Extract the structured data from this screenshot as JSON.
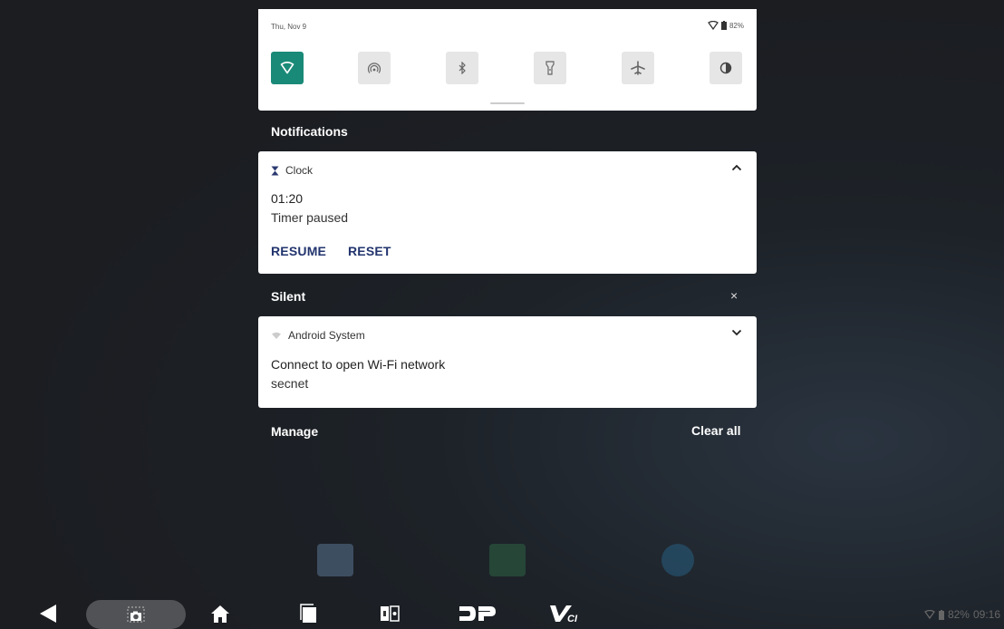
{
  "quick_settings": {
    "date": "Thu, Nov 9",
    "battery": "82%",
    "tiles": [
      {
        "name": "wifi",
        "icon": "wifi-icon",
        "active": true
      },
      {
        "name": "hotspot",
        "icon": "hotspot-icon",
        "active": false
      },
      {
        "name": "bluetooth",
        "icon": "bluetooth-icon",
        "active": false
      },
      {
        "name": "flashlight",
        "icon": "flashlight-icon",
        "active": false
      },
      {
        "name": "airplane",
        "icon": "airplane-icon",
        "active": false
      },
      {
        "name": "dark-theme",
        "icon": "contrast-icon",
        "active": false
      }
    ]
  },
  "notifications": {
    "heading": "Notifications",
    "clock": {
      "app": "Clock",
      "time": "01:20",
      "status": "Timer paused",
      "resume": "RESUME",
      "reset": "RESET"
    },
    "silent_heading": "Silent",
    "silent_close": "×",
    "android": {
      "app": "Android System",
      "title": "Connect to open Wi-Fi network",
      "network": "secnet"
    },
    "manage": "Manage",
    "clear_all": "Clear all"
  },
  "status_bar": {
    "battery": "82%",
    "time": "09:16"
  },
  "colors": {
    "accent": "#1a8a78",
    "action_text": "#22346e"
  }
}
